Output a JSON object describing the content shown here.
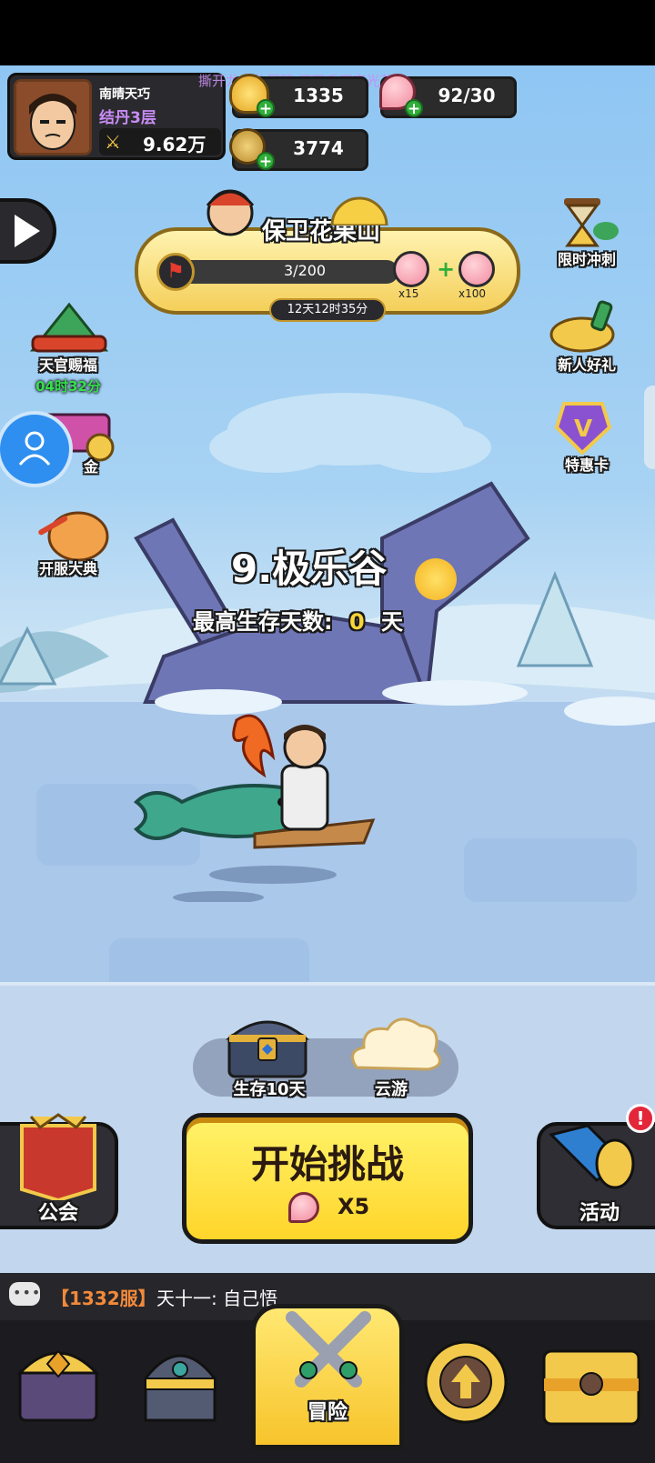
{
  "player": {
    "name": "南晴天巧",
    "realm": "结丹3层",
    "power": "9.62万"
  },
  "marquee": "撕开龙色的屏障 洒下千万束光芒",
  "currencies": {
    "gold_ingot": "1335",
    "peach": "92/30",
    "coin": "3774"
  },
  "event": {
    "title": "保卫花果山",
    "progress_text": "3/200",
    "progress": 0.015,
    "reward_1": "x15",
    "reward_2": "x100",
    "timer": "12天12时35分"
  },
  "left_menu": {
    "tianguan": "天官赐福",
    "tianguan_timer": "04时32分",
    "jijin": "金",
    "kaifu": "开服大典"
  },
  "right_menu": {
    "xianshi": "限时冲刺",
    "xinren": "新人好礼",
    "tehui": "特惠卡"
  },
  "stage": {
    "name": "9.极乐谷",
    "survival_label": "最高生存天数:",
    "survival_days": "0",
    "survival_unit": "天"
  },
  "actions": {
    "chest_label": "生存10天",
    "cloud_label": "云游",
    "guild_label": "公会",
    "start_label": "开始挑战",
    "start_cost": "X5",
    "activity_label": "活动",
    "activity_badge": "!"
  },
  "chat": {
    "server": "【1332服】",
    "message": "天十一: 自己悟"
  },
  "tabs": {
    "adventure": "冒险"
  },
  "colors": {
    "accent_yellow": "#f9d43a",
    "button_yellow": "#ffe34d",
    "green_timer": "#35e04a",
    "realm_purple": "#c98cf6"
  }
}
